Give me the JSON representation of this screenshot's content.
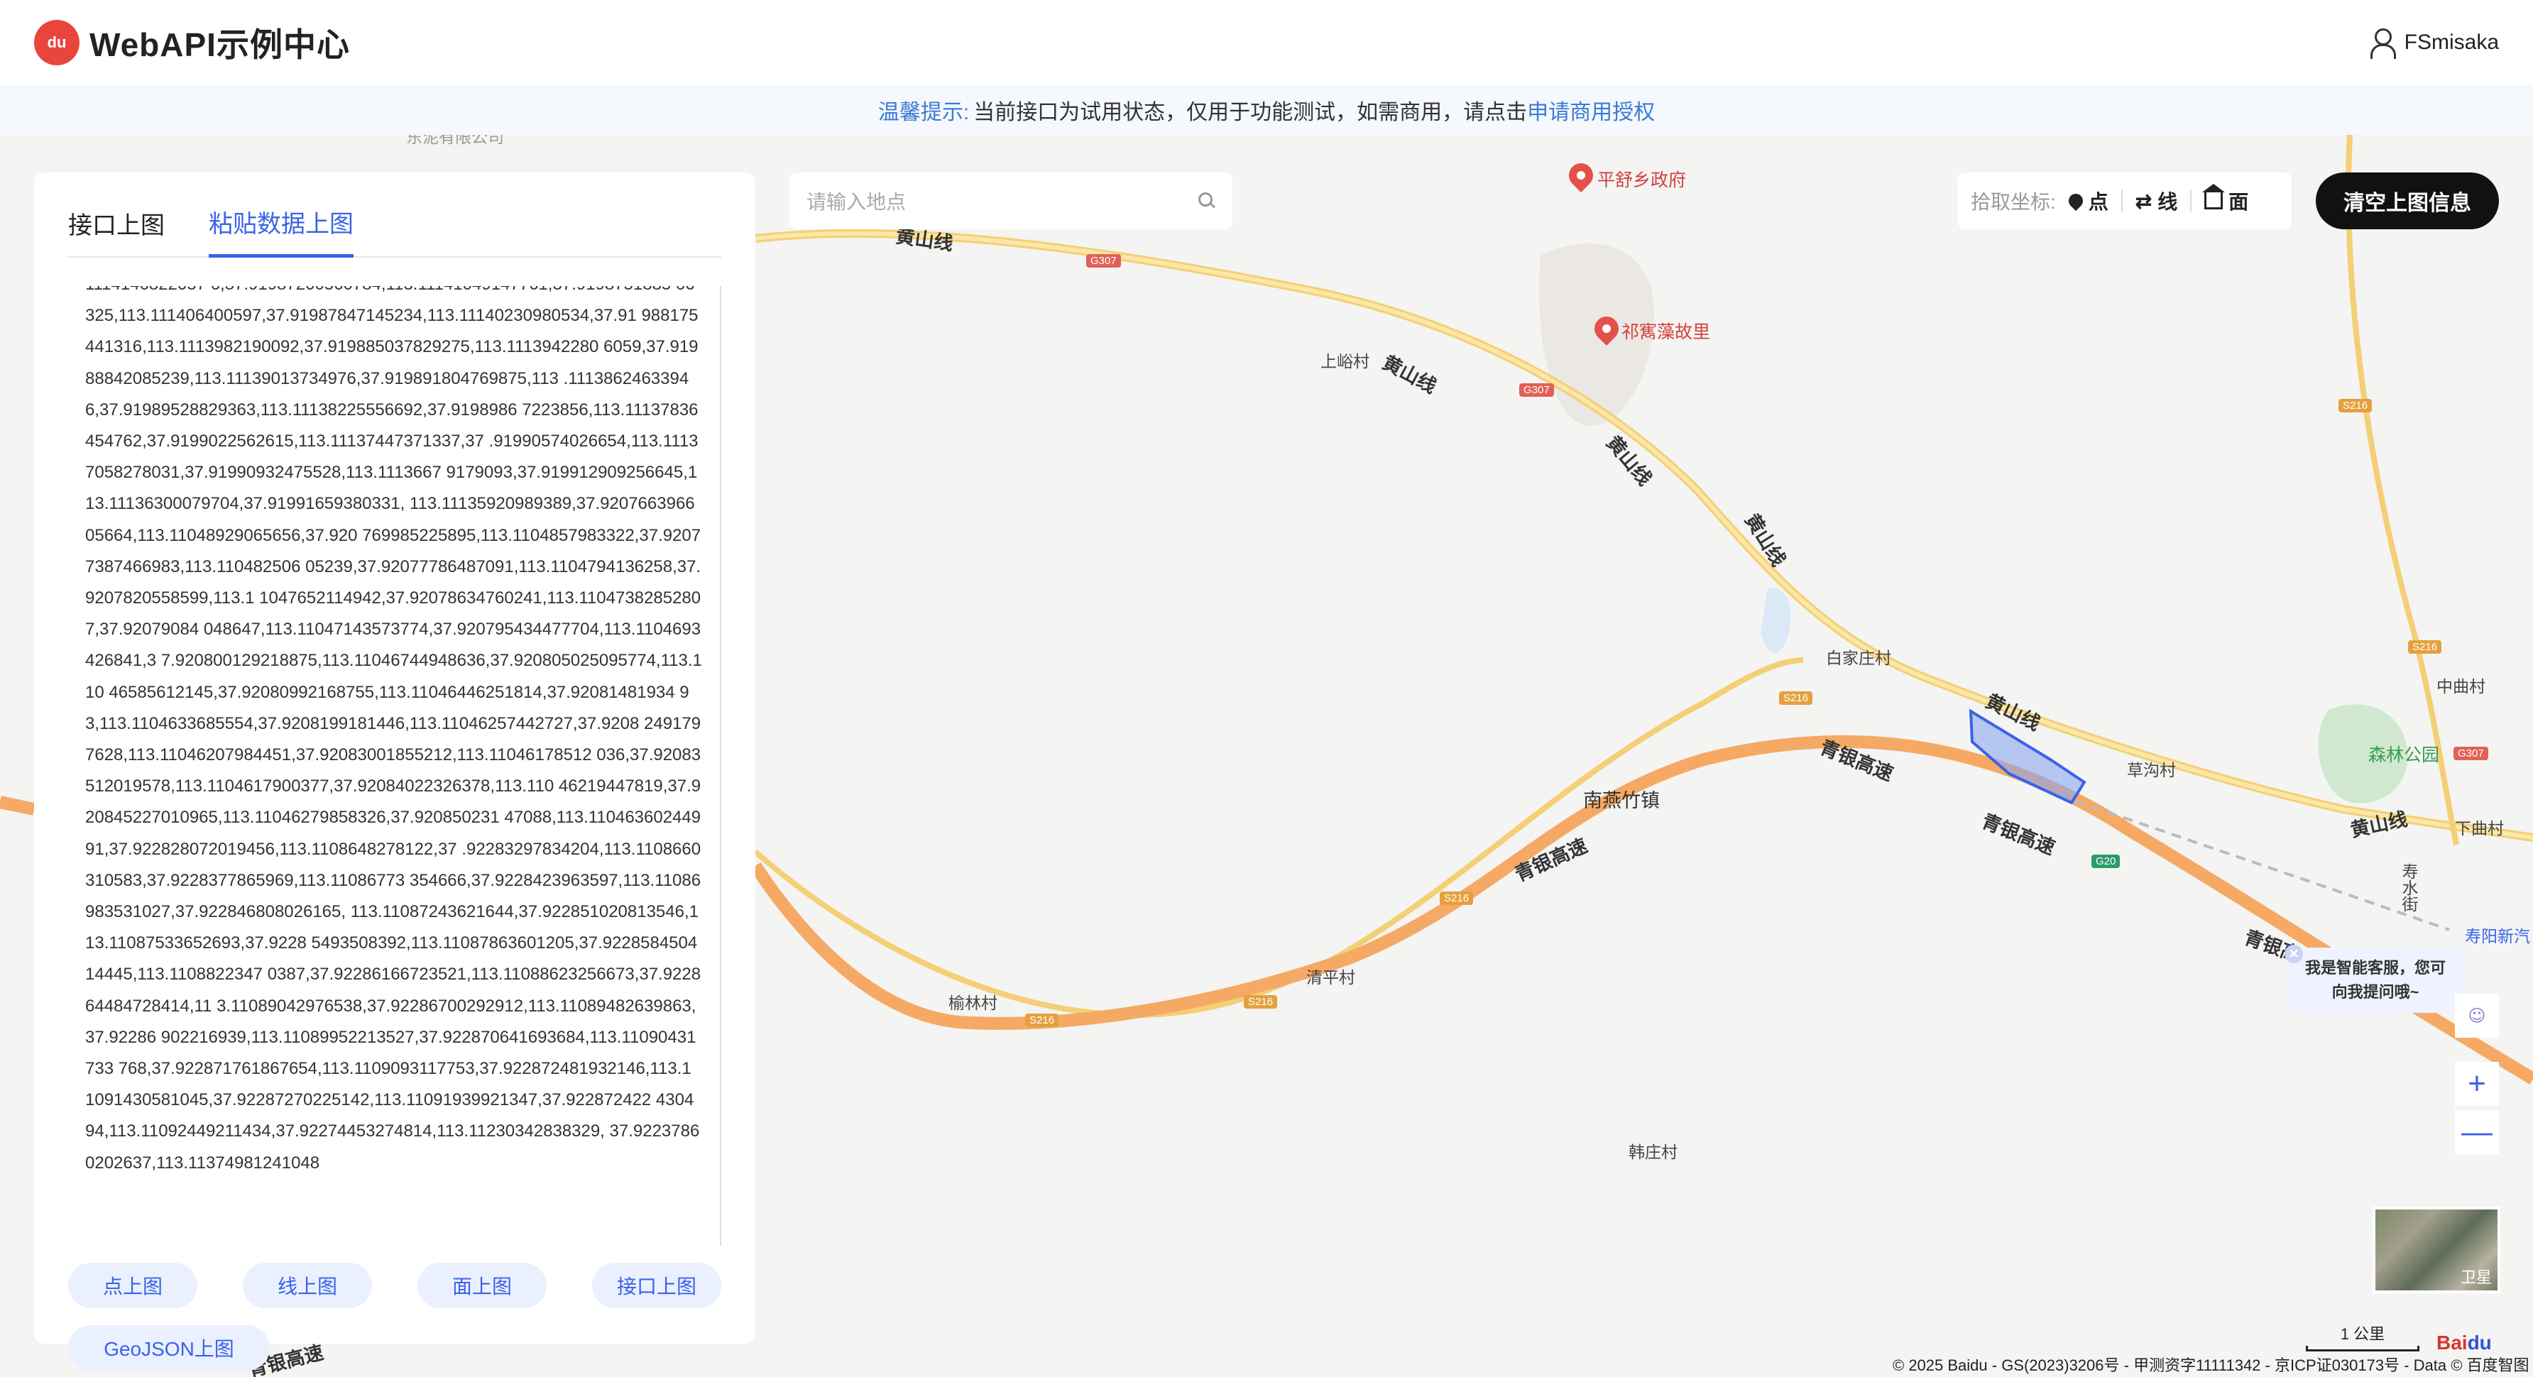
{
  "header": {
    "logo_text": "du",
    "brand": "WebAPI示例中心",
    "username": "FSmisaka"
  },
  "notice": {
    "tip": "温馨提示:",
    "text": "当前接口为试用状态，仅用于功能测试，如需商用，请点击",
    "link": "申请商用授权"
  },
  "panel": {
    "tabs": [
      {
        "label": "接口上图",
        "active": false
      },
      {
        "label": "粘贴数据上图",
        "active": true
      }
    ],
    "textarea_value": "1114146822057 6,37.91987200560784,113.11141049147761,37.9198751885 06325,113.111406400597,37.91987847145234,113.11140230980534,37.91 988175441316,113.1113982190092,37.919885037829275,113.1113942280 6059,37.91988842085239,113.11139013734976,37.919891804769875,113 .11138624633946,37.91989528829363,113.11138225556692,37.9198986 7223856,113.11137836454762,37.9199022562615,113.11137447371337,37 .91990574026654,113.11137058278031,37.91990932475528,113.1113667 9179093,37.919912909256645,113.11136300079704,37.91991659380331, 113.11135920989389,37.920766396605664,113.11048929065656,37.920 769985225895,113.1104857983322,37.92077387466983,113.110482506 05239,37.92077786487091,113.1104794136258,37.9207820558599,113.1 1047652114942,37.92078634760241,113.11047382852807,37.92079084 048647,113.11047143573774,37.920795434477704,113.1104693426841,3 7.920800129218875,113.11046744948636,37.920805025095774,113.110 46585612145,37.92080992168755,113.11046446251814,37.92081481934 93,113.1104633685554,37.9208199181446,113.11046257442727,37.9208 2491797628,113.11046207984451,37.92083001855212,113.11046178512 036,37.92083512019578,113.1104617900377,37.92084022326378,113.110 46219447819,37.920845227010965,113.11046279858326,37.920850231 47088,113.11046360244991,37.922828072019456,113.1108648278122,37 .92283297834204,113.1108660310583,37.9228377865969,113.11086773 354666,37.9228423963597,113.11086983531027,37.922846808026165, 113.11087243621644,37.922851020813546,113.11087533652693,37.9228 5493508392,113.11087863601205,37.922858450414445,113.1108822347 0387,37.92286166723521,113.11088623256673,37.922864484728414,11 3.11089042976538,37.92286700292912,113.11089482639863,37.92286 902216939,113.11089952213527,37.922870641693684,113.11090431733 768,37.922871761867654,113.1109093117753,37.922872481932146,113.1 1091430581045,37.92287270225142,113.11091939921347,37.922872422 430494,113.11092449211434,37.92274453274814,113.11230342838329, 37.92237860202637,113.11374981241048",
    "buttons": [
      "点上图",
      "线上图",
      "面上图",
      "接口上图"
    ],
    "geojson_button": "GeoJSON上图"
  },
  "search": {
    "placeholder": "请输入地点"
  },
  "picker": {
    "label": "拾取坐标:",
    "point": "点",
    "line": "线",
    "polygon": "面"
  },
  "clear_button": "清空上图信息",
  "assistant": {
    "text": "我是智能客服，您可向我提问哦~"
  },
  "zoom": {
    "in": "+",
    "out": "—"
  },
  "satellite_label": "卫星",
  "scale_label": "1 公里",
  "copyright": "© 2025 Baidu - GS(2023)3206号 - 甲测资字11111342 - 京ICP证030173号 - Data © 百度智图",
  "map": {
    "places": {
      "pingshu": "平舒乡政府",
      "qiyuanzao": "祁寯藻故里",
      "shangyu": "上峪村",
      "baijiazhuang": "白家庄村",
      "nanyanzhu": "南燕竹镇",
      "caogou": "草沟村",
      "senlin": "森林公园",
      "zhongqu": "中曲村",
      "xiaqu": "下曲村",
      "shoushuijie": "寿水街",
      "shouyang": "寿阳新汽",
      "qingping": "清平村",
      "yulin": "榆林村",
      "hanzhuang": "韩庄村",
      "company": "东泥有限公司"
    },
    "roads": {
      "huangshan": "黄山线",
      "qingyin": "青银高速"
    },
    "shields": {
      "g307": "G307",
      "s216": "S216",
      "g20": "G20"
    }
  }
}
